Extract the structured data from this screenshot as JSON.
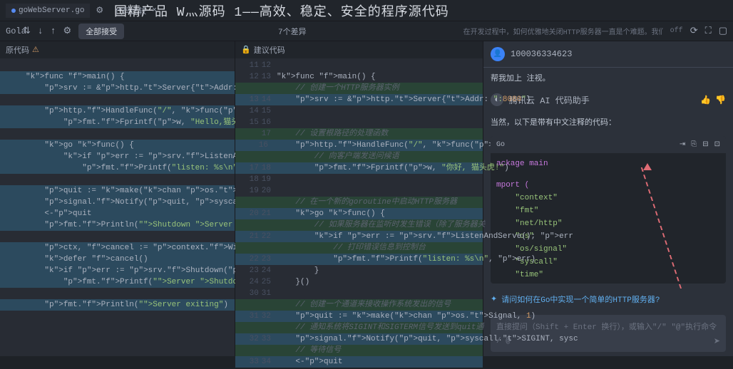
{
  "headline": "国精产品 W灬源码 1——高效、稳定、安全的程序源代码",
  "tabs": {
    "file": "goWebServer.go",
    "compare": "代码比较"
  },
  "toolbar": {
    "accept_all": "全部接受",
    "diff_count": "7个差异",
    "off": "off",
    "right_text": "在开发过程中，如何优雅地关闭HTTP服务器一直是个难题。我们需要一种..."
  },
  "panes": {
    "original": "原代码",
    "suggested": "建议代码"
  },
  "code_left": [
    {
      "n": "",
      "t": ""
    },
    {
      "n": "",
      "t": "func main() {",
      "cls": "hl"
    },
    {
      "n": "",
      "t": "    srv := &http.Server{Addr: \":8080\"}",
      "cls": "hl"
    },
    {
      "n": "",
      "t": ""
    },
    {
      "n": "",
      "t": "    http.HandleFunc(\"/\", func(w http.Response",
      "cls": "hl"
    },
    {
      "n": "",
      "t": "        fmt.Fprintf(w, \"Hello,猫头虎!\")",
      "cls": "hl"
    },
    {
      "n": "",
      "t": ""
    },
    {
      "n": "",
      "t": "    go func() {",
      "cls": "hl"
    },
    {
      "n": "",
      "t": "        if err := srv.ListenAndServe(); err !",
      "cls": "hl"
    },
    {
      "n": "",
      "t": "            fmt.Printf(\"listen: %s\\n\", err)",
      "cls": "hl"
    },
    {
      "n": "",
      "t": ""
    },
    {
      "n": "",
      "t": "    quit := make(chan os.Signal, 1)",
      "cls": "hl"
    },
    {
      "n": "",
      "t": "    signal.Notify(quit, syscall.SIGINT, sysca",
      "cls": "hl"
    },
    {
      "n": "",
      "t": "    <-quit",
      "cls": "hl"
    },
    {
      "n": "",
      "t": "    fmt.Println(\"Shutdown Server ...\")",
      "cls": "hl"
    },
    {
      "n": "",
      "t": ""
    },
    {
      "n": "",
      "t": "    ctx, cancel := context.WithTimeout(contex",
      "cls": "hl"
    },
    {
      "n": "",
      "t": "    defer cancel()",
      "cls": "hl"
    },
    {
      "n": "",
      "t": "    if err := srv.Shutdown(ctx); err != nil {",
      "cls": "hl"
    },
    {
      "n": "",
      "t": "        fmt.Printf(\"Server Shutdown: %s\\n\", e",
      "cls": "hl"
    },
    {
      "n": "",
      "t": ""
    },
    {
      "n": "",
      "t": "    fmt.Println(\"Server exiting\")",
      "cls": "hl"
    }
  ],
  "code_mid": [
    {
      "n": "11",
      "n2": "12",
      "t": ""
    },
    {
      "n": "12",
      "n2": "13",
      "t": "func main() {"
    },
    {
      "n": "",
      "n2": "",
      "t": "    // 创建一个HTTP服务器实例",
      "cls": "hl-add c"
    },
    {
      "n": "13",
      "n2": "14",
      "t": "    srv := &http.Server{Addr: \":8080\"}",
      "cls": "hl"
    },
    {
      "n": "14",
      "n2": "15",
      "t": ""
    },
    {
      "n": "15",
      "n2": "16",
      "t": ""
    },
    {
      "n": "",
      "n2": "17",
      "t": "    // 设置根路径的处理函数",
      "cls": "hl-add c"
    },
    {
      "n": "16",
      "n2": "",
      "t": "    http.HandleFunc(\"/\", func(w http.Respons",
      "cls": "hl"
    },
    {
      "n": "",
      "n2": "",
      "t": "        // 向客户端发送问候语",
      "cls": "hl-add c"
    },
    {
      "n": "17",
      "n2": "18",
      "t": "        fmt.Fprintf(w, \"你好, 猫头虎!\")",
      "cls": "hl"
    },
    {
      "n": "18",
      "n2": "19",
      "t": ""
    },
    {
      "n": "19",
      "n2": "20",
      "t": ""
    },
    {
      "n": "",
      "n2": "",
      "t": "    // 在一个新的goroutine中启动HTTP服务器",
      "cls": "hl-add c"
    },
    {
      "n": "20",
      "n2": "21",
      "t": "    go func() {",
      "cls": "hl"
    },
    {
      "n": "",
      "n2": "",
      "t": "        // 如果服务器在监听时发生错误（除了服务器关",
      "cls": "hl-add c"
    },
    {
      "n": "21",
      "n2": "22",
      "t": "        if err := srv.ListenAndServe(); err",
      "cls": "hl"
    },
    {
      "n": "",
      "n2": "",
      "t": "            // 打印错误信息到控制台",
      "cls": "hl-add c"
    },
    {
      "n": "22",
      "n2": "23",
      "t": "            fmt.Printf(\"listen: %s\\n\", err)",
      "cls": "hl"
    },
    {
      "n": "23",
      "n2": "24",
      "t": "        }"
    },
    {
      "n": "24",
      "n2": "25",
      "t": "    }()"
    },
    {
      "n": "30",
      "n2": "31",
      "t": ""
    },
    {
      "n": "",
      "n2": "",
      "t": "    // 创建一个通道来接收操作系统发出的信号",
      "cls": "hl-add c"
    },
    {
      "n": "31",
      "n2": "32",
      "t": "    quit := make(chan os.Signal, 1)",
      "cls": "hl"
    },
    {
      "n": "",
      "n2": "",
      "t": "    // 通知系统将SIGINT和SIGTERM信号发送到quit通",
      "cls": "hl-add c"
    },
    {
      "n": "32",
      "n2": "33",
      "t": "    signal.Notify(quit, syscall.SIGINT, sysc",
      "cls": "hl"
    },
    {
      "n": "",
      "n2": "",
      "t": "    // 等待信号",
      "cls": "hl-add c"
    },
    {
      "n": "33",
      "n2": "34",
      "t": "    <-quit",
      "cls": "hl"
    }
  ],
  "ai": {
    "user_id": "100036334623",
    "user_msg": "帮我加上 注视。",
    "assist_name": "腾讯云 AI 代码助手",
    "assist_msg": "当然，以下是带有中文注释的代码：",
    "lang": "Go",
    "pkg": "ackage main",
    "imp": "mport (",
    "imports": [
      "\"context\"",
      "\"fmt\"",
      "\"net/http\"",
      "\"os\"",
      "\"os/signal\"",
      "\"syscall\"",
      "\"time\""
    ],
    "suggestion": "请问如何在Go中实现一个简单的HTTP服务器?",
    "placeholder": "直接提问（Shift + Enter 换行），或输入\"/\" \"@\"执行命令",
    "prompt": "/ @"
  }
}
